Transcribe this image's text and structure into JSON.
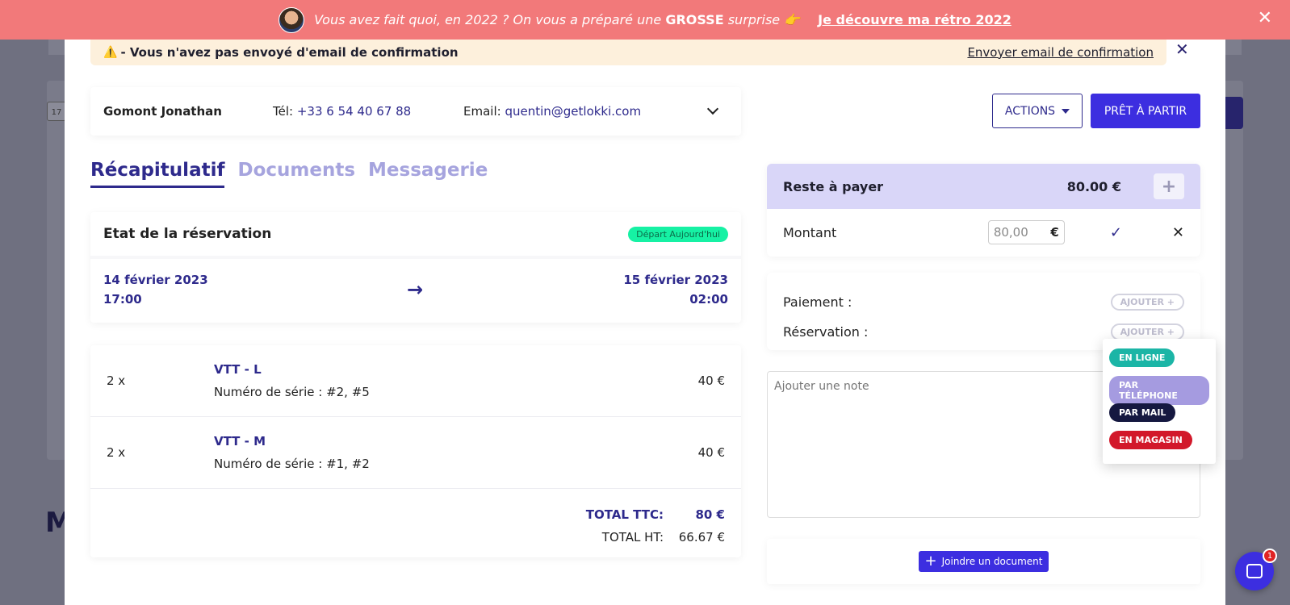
{
  "promo": {
    "message_pre": "Vous avez fait quoi, en 2022 ? On vous a préparé une ",
    "message_bold": "GROSSE",
    "message_post": " surprise 👉",
    "link": "Je découvre ma rétro 2022",
    "close": "✕"
  },
  "background": {
    "letter": "M",
    "calendar": "17"
  },
  "warning": {
    "icon": "⚠️",
    "text": " - Vous n'avez pas envoyé d'email de confirmation",
    "action": "Envoyer email de confirmation"
  },
  "modal": {
    "close": "✕"
  },
  "client": {
    "name": "Gomont Jonathan",
    "tel_label": "Tél: ",
    "tel": "+33 6 54 40 67 88",
    "email_label": "Email: ",
    "email": "quentin@getlokki.com"
  },
  "buttons": {
    "actions": "ACTIONS",
    "ready": "PRÊT À PARTIR"
  },
  "tabs": [
    "Récapitulatif",
    "Documents",
    "Messagerie"
  ],
  "reservation": {
    "title": "Etat de la réservation",
    "badge": "Départ Aujourd'hui",
    "start_date": "14 février 2023",
    "start_time": "17:00",
    "end_date": "15 février 2023",
    "end_time": "02:00",
    "arrow": "→"
  },
  "items": [
    {
      "qty": "2 x",
      "name": "VTT - L",
      "serial": "Numéro de série : #2, #5",
      "price": "40 €"
    },
    {
      "qty": "2 x",
      "name": "VTT - M",
      "serial": "Numéro de série : #1, #2",
      "price": "40 €"
    }
  ],
  "totals": {
    "ttc_label": "TOTAL TTC:",
    "ttc": "80 €",
    "ht_label": "TOTAL HT:",
    "ht": "66.67 €"
  },
  "payment": {
    "remaining_label": "Reste à payer",
    "remaining": "80.00 €",
    "plus": "+",
    "amount_label": "Montant",
    "amount_placeholder": "80,00",
    "currency": "€",
    "confirm": "✓",
    "cancel": "✕"
  },
  "methods": {
    "payment_label": "Paiement :",
    "reservation_label": "Réservation :",
    "add": "AJOUTER +"
  },
  "note": {
    "placeholder": "Ajouter une note"
  },
  "document": {
    "button": "Joindre un document",
    "plus": "+"
  },
  "dropdown": {
    "options": [
      {
        "label": "EN LIGNE",
        "color": "#1bb5a6"
      },
      {
        "label": "PAR TÉLÉPHONE",
        "color": "#a59be0"
      },
      {
        "label": "PAR MAIL",
        "color": "#151840"
      },
      {
        "label": "EN MAGASIN",
        "color": "#d2182a"
      }
    ]
  },
  "chat": {
    "count": "1"
  },
  "colors": {
    "primary": "#3c2ee0",
    "navy": "#2e2a8c",
    "banner": "#f2797a",
    "badge": "#16f1a4"
  }
}
